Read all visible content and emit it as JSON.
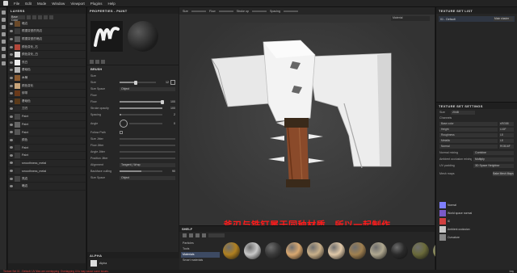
{
  "menu": [
    "File",
    "Edit",
    "Mode",
    "Window",
    "Viewport",
    "Plugins",
    "Help"
  ],
  "layers": {
    "title": "LAYERS",
    "blend_mode": "Base Color",
    "items": [
      {
        "name": "暗边",
        "type": "fill",
        "thumb": "#6b4a2a"
      },
      {
        "name": "根据变型的亮边",
        "type": "fill",
        "thumb": "#3a3a3a"
      },
      {
        "name": "根据变型的暗边",
        "type": "fill",
        "thumb": "#5a5a5a"
      },
      {
        "name": "颜色变化_右",
        "type": "fill",
        "thumb": "#b3473a"
      },
      {
        "name": "颜色变化_白",
        "type": "fill",
        "thumb": "#dddddd"
      },
      {
        "name": "亮白",
        "type": "fill",
        "thumb": "#efefef"
      },
      {
        "name": "基础色",
        "type": "fill",
        "thumb": "#b8b8b8"
      },
      {
        "name": "木柄",
        "type": "folder",
        "thumb": "#8a5a30"
      },
      {
        "name": "颜色变化",
        "type": "fill",
        "thumb": "#c9a57a"
      },
      {
        "name": "绑带",
        "type": "fill",
        "thumb": "#6a3a1a"
      },
      {
        "name": "基础色",
        "type": "fill",
        "thumb": "#5a3a1a"
      },
      {
        "name": "刀刃",
        "type": "folder",
        "thumb": "#2a2a2a"
      },
      {
        "name": "Paint",
        "type": "paint",
        "thumb": "#444444"
      },
      {
        "name": "Paint",
        "type": "paint",
        "thumb": "#666666"
      },
      {
        "name": "Paint",
        "type": "paint",
        "thumb": "#555555"
      },
      {
        "name": "颜色",
        "type": "fill",
        "thumb": "#222222"
      },
      {
        "name": "Paint",
        "type": "paint",
        "thumb": "#333333"
      },
      {
        "name": "Paint",
        "type": "paint",
        "thumb": "#3a3a3a"
      },
      {
        "name": "smoothness_metal",
        "type": "fill",
        "thumb": "#2d2d2d"
      },
      {
        "name": "smoothness_metal",
        "type": "fill",
        "thumb": "#2d2d2d"
      },
      {
        "name": "亮边",
        "type": "folder",
        "thumb": "#444444"
      },
      {
        "name": "暗边",
        "type": "folder",
        "thumb": "#2a2a2a"
      }
    ]
  },
  "properties": {
    "title": "PROPERTIES - PAINT",
    "brush_section": "BRUSH",
    "size_group": "Size",
    "size_label": "Size",
    "size_value": "12",
    "size_fill": 0.45,
    "size_space_label": "Size Space",
    "size_space_value": "Object",
    "flow_group": "Flow",
    "flow_label": "Flow",
    "flow_value": "100",
    "flow_fill": 1.0,
    "stroke_opacity_label": "Stroke opacity",
    "stroke_opacity_value": "100",
    "spacing_label": "Spacing",
    "spacing_value": "2",
    "angle_label": "Angle",
    "angle_value": "0",
    "follow_path_label": "Follow Path",
    "size_jitter_label": "Size Jitter",
    "flow_jitter_label": "Flow Jitter",
    "angle_jitter_label": "Angle Jitter",
    "position_jitter_label": "Position Jitter",
    "alignment_label": "Alignment",
    "alignment_value": "Tangent | Wrap",
    "backface_label": "Backface culling",
    "backface_value": "90",
    "size_space_bottom_label": "Size Space",
    "size_space_bottom_value": "Object",
    "alpha_title": "ALPHA",
    "alpha_name": "Alpha"
  },
  "viewport": {
    "toolbar": [
      "Size",
      "Flow",
      "Stroke op",
      "Spacing"
    ],
    "material_dropdown": "Material",
    "subtitle": "斧刃与铁钉属于同种材质，所以一起制作"
  },
  "shelf": {
    "title": "SHELF",
    "categories": [
      "Particles",
      "Tools",
      "Materials",
      "Smart materials"
    ],
    "selected_category": "Materials",
    "materials": [
      "#b08020",
      "#c8c8c8",
      "#3a3a3a",
      "#d9a870",
      "#c9b08a",
      "#e0c8a8",
      "#a08050",
      "#b0a890",
      "#2a2a2a",
      "#6a6a3a",
      "#8a8a5a",
      "#9a9a9a"
    ]
  },
  "texture_set_list": {
    "title": "TEXTURE SET LIST",
    "item": "01 - Default",
    "shader": "Main shader"
  },
  "texture_set_settings": {
    "title": "TEXTURE SET SETTINGS",
    "size_label": "Size",
    "size_value": "2048",
    "channels_label": "Channels",
    "channels": [
      {
        "name": "Base color",
        "format": "sRGB8"
      },
      {
        "name": "Height",
        "format": "L16F"
      },
      {
        "name": "Roughness",
        "format": "L8"
      },
      {
        "name": "Metallic",
        "format": "L8"
      },
      {
        "name": "Normal",
        "format": "RGB16F"
      }
    ],
    "normal_mix_label": "Normal mixing",
    "normal_mix_value": "Combine",
    "ao_mix_label": "Ambient occlusion mixing",
    "ao_mix_value": "Multiply",
    "uv_padding_label": "UV padding",
    "uv_padding_value": "3D Space Neighbor",
    "mesh_maps_label": "Mesh maps",
    "bake_button": "Bake Mesh Maps",
    "maps": [
      {
        "name": "Normal",
        "color": "#7f7fff"
      },
      {
        "name": "World space normal",
        "color": "#7a5ac8"
      },
      {
        "name": "ID",
        "color": "#d04040"
      },
      {
        "name": "Ambient occlusion",
        "color": "#c8c8c8"
      },
      {
        "name": "Curvature",
        "color": "#8a8a8a"
      }
    ]
  },
  "status": {
    "warning": "Texture Set 01 - Default: UV tiles are overlapping. Overlapping UVs may cause some issues.",
    "engine": "Iray"
  }
}
